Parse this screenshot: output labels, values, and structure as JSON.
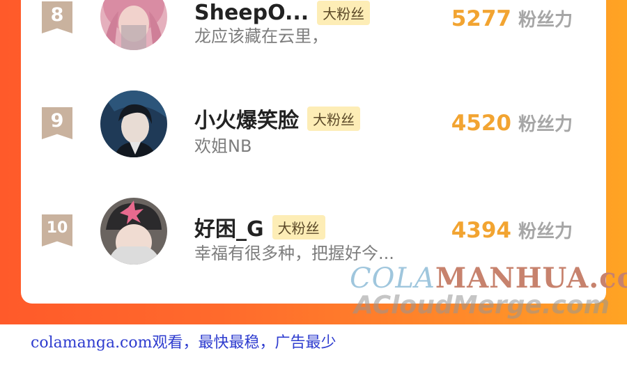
{
  "leaderboard": {
    "entries": [
      {
        "rank": "8",
        "username": "SheepO...",
        "badge": "大粉丝",
        "comment": "龙应该藏在云里，",
        "score": "5277",
        "score_unit": "粉丝力",
        "avatar": "pink-hair-avatar"
      },
      {
        "rank": "9",
        "username": "小火爆笑脸",
        "badge": "大粉丝",
        "comment": "欢姐NB",
        "score": "4520",
        "score_unit": "粉丝力",
        "avatar": "anime-character-avatar"
      },
      {
        "rank": "10",
        "username": "好困_G",
        "badge": "大粉丝",
        "comment": "幸福有很多种，把握好今...",
        "score": "4394",
        "score_unit": "粉丝力",
        "avatar": "girl-with-hat-avatar"
      }
    ]
  },
  "watermarks": {
    "line1_a": "COLA",
    "line1_b": "MANHUA.com",
    "line2": "ACloudMerge.com"
  },
  "footer": {
    "text": "colamanga.com观看，最快最稳，广告最少"
  },
  "colors": {
    "frame_start": "#ff5a2a",
    "frame_end": "#ffa424",
    "rank_badge": "#c9b29e",
    "fan_badge_bg": "#fdedb6",
    "score": "#f2a431",
    "footer_link": "#2e3ccf"
  }
}
